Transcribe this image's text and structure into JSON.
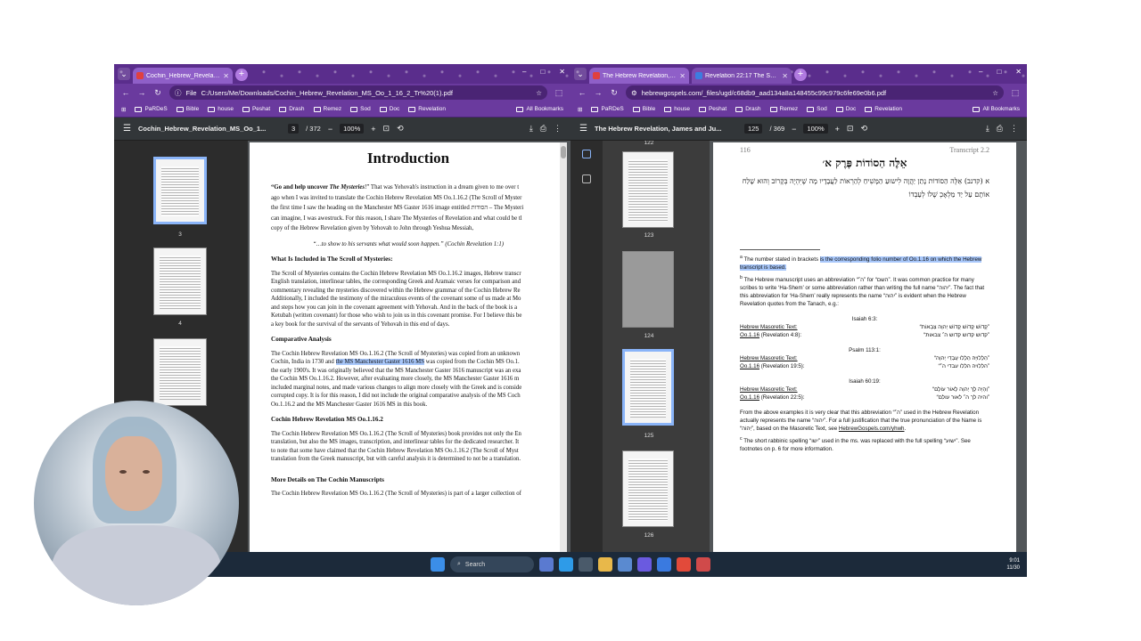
{
  "left_window": {
    "tabs": [
      {
        "title": "Cochin_Hebrew_Revelation_MS"
      }
    ],
    "window_controls": [
      "–",
      "□",
      "✕"
    ],
    "address": "C:/Users/Me/Downloads/Cochin_Hebrew_Revelation_MS_Oo_1_16_2_Tr%20(1).pdf",
    "address_prefix": "File",
    "bookmarks": [
      "PaRDeS",
      "Bible",
      "house",
      "Peshat",
      "Drash",
      "Remez",
      "Sod",
      "Doc",
      "Revelation"
    ],
    "all_bookmarks": "All Bookmarks",
    "pdf_name": "Cochin_Hebrew_Revelation_MS_Oo_1...",
    "page_input": "3",
    "page_total": "/ 372",
    "zoom": "100%",
    "thumb_labels": [
      "3",
      "4"
    ],
    "page": {
      "title": "Introduction",
      "p1a": "“Go and help uncover ",
      "p1b": "The Mysteries",
      "p1c": "!” That was Yehovah's instruction in a dream given to me over t",
      "p1d": "ago when I was invited to translate the Cochin Hebrew Revelation MS Oo.1.16.2 (The Scroll of Myster",
      "p1e": "the first time I saw the heading on the Manchester MS Gaster 1616 image entitled הסודות – The Mysteri",
      "p1f": "can imagine, I was awestruck. For this reason, I share The Mysteries of Revelation and what could be tl",
      "p1g": "copy of the Hebrew Revelation given by Yehovah to John through Yeshua Messiah,",
      "quote": "“…to show to his servants what would soon happen.” (Cochin Revelation 1:1)",
      "h_included": "What Is Included in The Scroll of Mysteries:",
      "included": [
        "The Scroll of Mysteries contains the Cochin Hebrew Revelation MS Oo.1.16.2 images, Hebrew transcr",
        "English translation, interlinear tables, the corresponding Greek and Aramaic verses for comparison and",
        "commentary revealing the mysteries discovered within the Hebrew grammar of the Cochin Hebrew Re",
        "Additionally, I included the testimony of the miraculous events of the covenant some of us made at Mo",
        "and steps how you can join in the covenant agreement with Yehovah. And in the back of the book is a",
        "Ketubah (written covenant) for those who wish to join us in this covenant promise. For I believe this be",
        "a key book for the survival of the servants of Yehovah in this end of days."
      ],
      "h_comparative": "Comparative Analysis",
      "comparative": [
        "The Cochin Hebrew Revelation MS Oo.1.16.2 (The Scroll of Mysteries) was copied from an unknown",
        "Cochin, India in 1730 and ",
        "the MS Manchester Gaster 1616 MS",
        " was copied from the Cochin MS Oo.1.",
        "the early 1900's. It was originally believed that the MS Manchester Gaster 1616 manuscript was an exa",
        "the Cochin MS Oo.1.16.2. However, after evaluating more closely, the MS Manchester Gaster 1616 m",
        "included marginal notes, and made various changes to align more closely with the Greek and is conside",
        "corrupted copy. It is for this reason, I did not include the original comparative analysis of the MS Coch",
        "Oo.1.16.2 and the MS Manchester Gaster 1616 MS in this book."
      ],
      "h_cochin": "Cochin Hebrew Revelation MS Oo.1.16.2",
      "cochin": [
        "The Cochin Hebrew Revelation MS Oo.1.16.2 (The Scroll of Mysteries) book provides not only the En",
        "translation, but also the MS images, transcription, and interlinear tables for the dedicated researcher. It",
        "to note that some have claimed that the Cochin Hebrew Revelation MS Oo.1.16.2 (The Scroll of Myst",
        "translation from the Greek manuscript, but with careful analysis it is determined to not be a translation."
      ],
      "h_more": "More Details on The Cochin Manuscripts",
      "more": "The Cochin Hebrew Revelation MS Oo.1.16.2 (The Scroll of Mysteries) is part of a larger collection of"
    }
  },
  "right_window": {
    "tabs": [
      {
        "title": "The Hebrew Revelation, James"
      },
      {
        "title": "Revelation 22:17 The Spirit and"
      }
    ],
    "window_controls": [
      "–",
      "□",
      "✕"
    ],
    "address": "hebrewgospels.com/_files/ugd/c68db9_aad134a8a148455c99c979c6fe69e0b6.pdf",
    "bookmarks": [
      "PaRDeS",
      "Bible",
      "house",
      "Peshat",
      "Drash",
      "Remez",
      "Sod",
      "Doc",
      "Revelation"
    ],
    "all_bookmarks": "All Bookmarks",
    "pdf_name": "The Hebrew Revelation, James and Ju...",
    "page_input": "125",
    "page_total": "/ 369",
    "zoom": "100%",
    "thumb_labels": [
      "122",
      "123",
      "124",
      "125",
      "126"
    ],
    "page": {
      "page_number": "116",
      "header_right": "Transcript 2.2",
      "heb_title": "אֵלֶּה הַסוֹדוֹת פֶּרֶק א׳",
      "heb_text": "א (קדנב) אֵלֶּה הַסוֹדוֹת נָתַן יַהֲוָה לִישוּעַ הַמָּשִׁיחַ לְהַרְאוֹת לַעֲבָדָיו מָה שֶׁיִּהְיֶה בְּקָרוֹב וְהוּא שָׁלַח אוֹתָם עַל יַד מַלְאָכְ שֶׁלֹו לְעַבְדוֹ",
      "fn_a_pre": "The number stated in brackets ",
      "fn_a_hl": "is the corresponding folio number of Oo.1.16 on which the Hebrew transcript is based.",
      "fn_b": "The Hebrew manuscript uses an abbreviation “ה׳” for “השם”. It was common practice for many scribes to write ‘Ha-Shem’ or some abbreviation rather than writing the full name “יהוה”. The fact that this abbreviation for ‘Ha-Shem’ really represents the name “יהוה” is evident when the Hebrew Revelation quotes from the Tanach, e.g.:",
      "refs": [
        {
          "title": "Isaiah 6:3:",
          "l1a": "Hebrew Masoretic Text:",
          "l1b": "“קָדוֹשׁ קָדוֹשׁ קָדוֹשׁ יְהוָה צְבָאוֹת”",
          "l2a": "Oo.1.16",
          "l2m": " (Revelation 4:8):",
          "l2b": "“קדוש קדוש קדוש ה׳ צבאות”"
        },
        {
          "title": "Psalm 113:1:",
          "l1a": "Hebrew Masoretic Text:",
          "l1b": "“הַלְלוּיָהּ הַלְלוּ עַבְדֵי יְהוָה”",
          "l2a": "Oo.1.16",
          "l2m": " (Revelation 19:5):",
          "l2b": "“הללויה הללו עבדי ה׳”"
        },
        {
          "title": "Isaiah 60:19:",
          "l1a": "Hebrew Masoretic Text:",
          "l1b": "“וְהָיָה לָךְ יְהוָה לְאוֹר עוֹלָם”",
          "l2a": "Oo.1.16",
          "l2m": " (Revelation 22:5):",
          "l2b": "“והיה לך ה׳ לאור עולם”"
        }
      ],
      "fn_c": "From the above examples it is very clear that this abbreviation “ה׳” used in the Hebrew Revelation actually represents the name “יהוה”. For a full justification that the true pronunciation of the Name is “יְהוֹה”, based on the Masoretic Text, see ",
      "fn_c_link": "HebrewGospels.com/yhwh",
      "fn_d": "The short rabbinic spelling “ישו” used in the ms. was replaced with the full spelling “ישוע”. See footnotes on p. 6 for more information."
    }
  },
  "taskbar": {
    "search_label": "Search",
    "time": "9:01",
    "date": "11/30"
  }
}
